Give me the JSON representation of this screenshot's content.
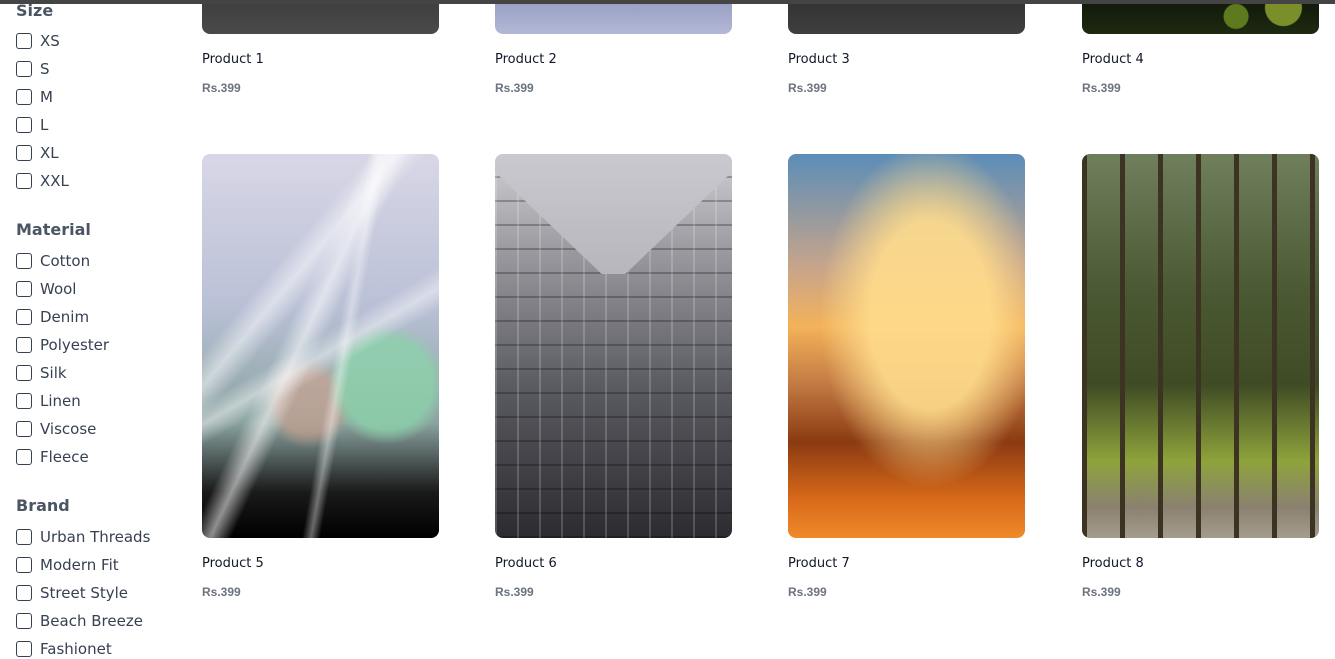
{
  "filters": {
    "size": {
      "title": "Size",
      "options": [
        "XS",
        "S",
        "M",
        "L",
        "XL",
        "XXL"
      ]
    },
    "material": {
      "title": "Material",
      "options": [
        "Cotton",
        "Wool",
        "Denim",
        "Polyester",
        "Silk",
        "Linen",
        "Viscose",
        "Fleece"
      ]
    },
    "brand": {
      "title": "Brand",
      "options": [
        "Urban Threads",
        "Modern Fit",
        "Street Style",
        "Beach Breeze",
        "Fashionet"
      ]
    }
  },
  "products": [
    {
      "name": "Product 1",
      "price": "Rs.399",
      "image": "dark-grey-photo"
    },
    {
      "name": "Product 2",
      "price": "Rs.399",
      "image": "blue-grey-photo"
    },
    {
      "name": "Product 3",
      "price": "Rs.399",
      "image": "dark-sea-photo"
    },
    {
      "name": "Product 4",
      "price": "Rs.399",
      "image": "leaves-photo"
    },
    {
      "name": "Product 5",
      "price": "Rs.399",
      "image": "concert-lights-photo"
    },
    {
      "name": "Product 6",
      "price": "Rs.399",
      "image": "skyscraper-photo"
    },
    {
      "name": "Product 7",
      "price": "Rs.399",
      "image": "sunset-mountain-photo"
    },
    {
      "name": "Product 8",
      "price": "Rs.399",
      "image": "forest-path-photo"
    }
  ]
}
